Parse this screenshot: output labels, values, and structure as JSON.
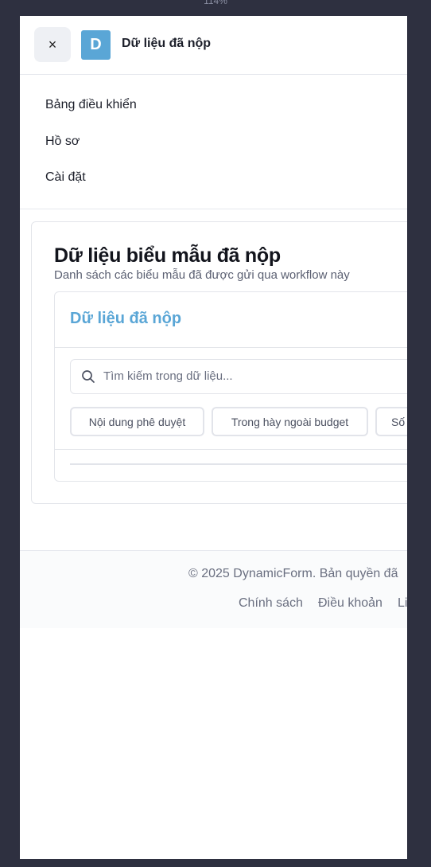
{
  "zoom_level": "114%",
  "header": {
    "close_icon": "×",
    "logo_letter": "D",
    "title": "Dữ liệu đã nộp"
  },
  "nav": {
    "items": [
      {
        "label": "Bảng điều khiển"
      },
      {
        "label": "Hồ sơ"
      },
      {
        "label": "Cài đặt"
      }
    ]
  },
  "main": {
    "title": "Dữ liệu biểu mẫu đã nộp",
    "subtitle": "Danh sách các biểu mẫu đã được gửi qua workflow này",
    "panel": {
      "title": "Dữ liệu đã nộp",
      "search": {
        "placeholder": "Tìm kiếm trong dữ liệu...",
        "value": ""
      },
      "columns": [
        {
          "label": "Nội dung phê duyệt"
        },
        {
          "label": "Trong hày ngoài budget"
        },
        {
          "label": "Số"
        }
      ]
    }
  },
  "footer": {
    "copyright": "© 2025 DynamicForm. Bản quyền đã",
    "links": [
      {
        "label": "Chính sách"
      },
      {
        "label": "Điều khoản"
      },
      {
        "label": "Li"
      }
    ]
  },
  "colors": {
    "accent": "#5aa6d6",
    "background": "#2e3040"
  },
  "icons": {
    "close": "close-icon",
    "search": "search-icon"
  }
}
